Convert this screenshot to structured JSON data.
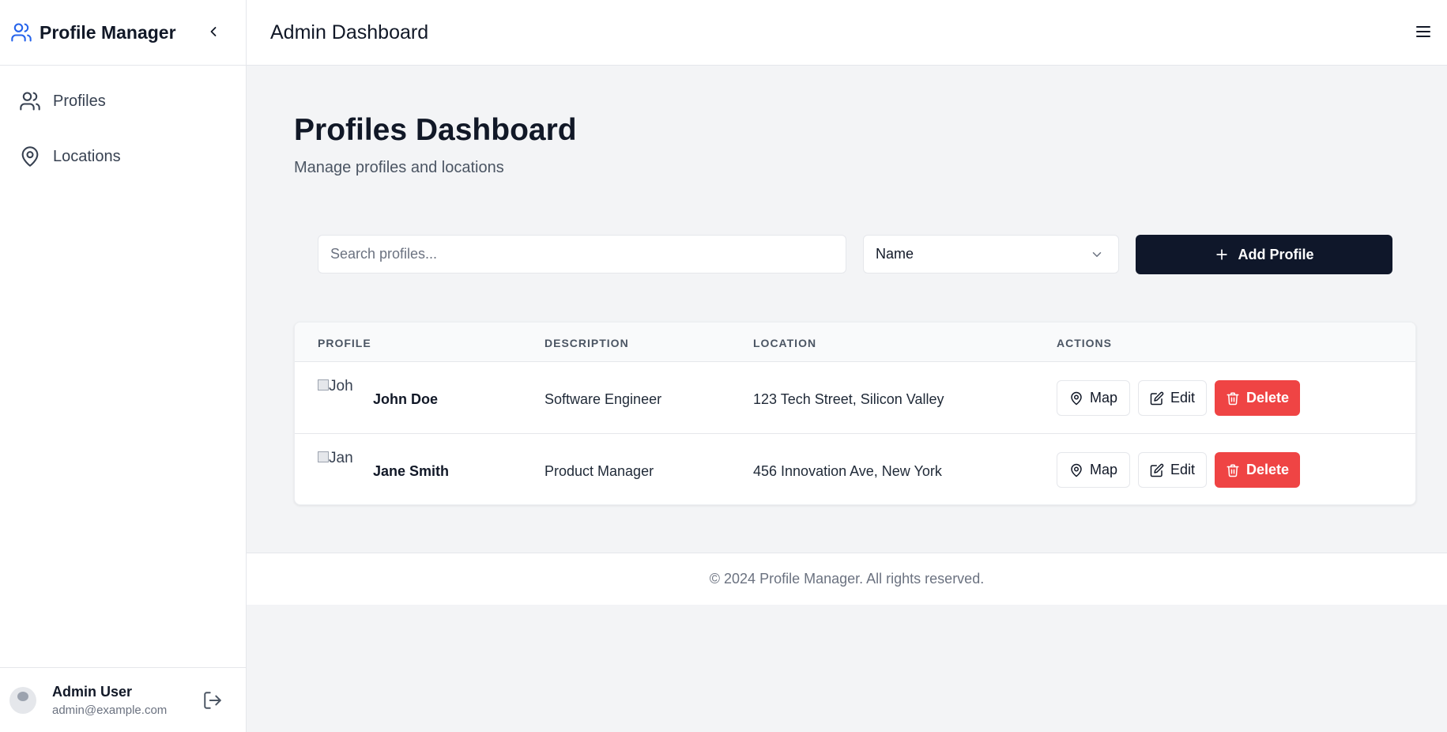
{
  "sidebar": {
    "brand": "Profile Manager",
    "nav": [
      {
        "label": "Profiles",
        "icon": "users-icon"
      },
      {
        "label": "Locations",
        "icon": "map-pin-icon"
      }
    ],
    "user": {
      "avatar_alt": "Use",
      "name": "Admin User",
      "email": "admin@example.com"
    }
  },
  "topbar": {
    "title": "Admin Dashboard"
  },
  "main": {
    "title": "Profiles Dashboard",
    "subtitle": "Manage profiles and locations",
    "search_placeholder": "Search profiles...",
    "sort_value": "Name",
    "add_label": "Add Profile"
  },
  "table": {
    "headers": [
      "PROFILE",
      "DESCRIPTION",
      "LOCATION",
      "ACTIONS"
    ],
    "rows": [
      {
        "img_alt": "Joh",
        "name": "John Doe",
        "description": "Software Engineer",
        "location": "123 Tech Street, Silicon Valley"
      },
      {
        "img_alt": "Jan",
        "name": "Jane Smith",
        "description": "Product Manager",
        "location": "456 Innovation Ave, New York"
      }
    ],
    "actions": {
      "map": "Map",
      "edit": "Edit",
      "delete": "Delete"
    }
  },
  "footer": {
    "text": "© 2024 Profile Manager. All rights reserved."
  },
  "colors": {
    "brand_icon": "#2563eb",
    "primary_button": "#0f172a",
    "danger": "#ef4444"
  }
}
